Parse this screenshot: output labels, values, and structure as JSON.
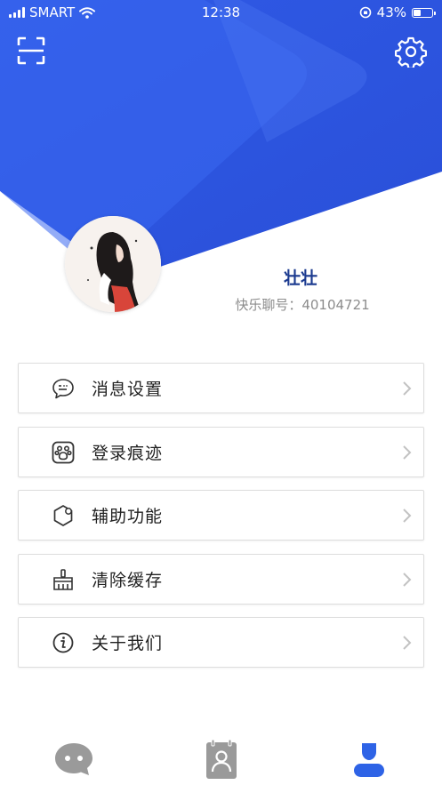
{
  "status_bar": {
    "carrier": "SMART",
    "time": "12:38",
    "battery_percent": "43%",
    "battery_level": 0.43
  },
  "header": {
    "scan_icon": "scan-icon",
    "settings_icon": "gear-icon",
    "gradient_colors": [
      "#2e56e0",
      "#3f6ff0"
    ]
  },
  "profile": {
    "avatar": "avatar-image",
    "name": "壮壮",
    "id_label": "快乐聊号：40104721"
  },
  "menu": {
    "items": [
      {
        "label": "消息设置",
        "icon": "message-icon"
      },
      {
        "label": "登录痕迹",
        "icon": "paw-icon"
      },
      {
        "label": "辅助功能",
        "icon": "hexagon-icon"
      },
      {
        "label": "清除缓存",
        "icon": "broom-icon"
      },
      {
        "label": "关于我们",
        "icon": "info-icon"
      }
    ]
  },
  "tabbar": {
    "tabs": [
      {
        "icon": "chat-icon",
        "active": false
      },
      {
        "icon": "contacts-icon",
        "active": false
      },
      {
        "icon": "profile-icon",
        "active": true
      }
    ],
    "active_color": "#2e63e6",
    "inactive_color": "#9a9a9a"
  }
}
